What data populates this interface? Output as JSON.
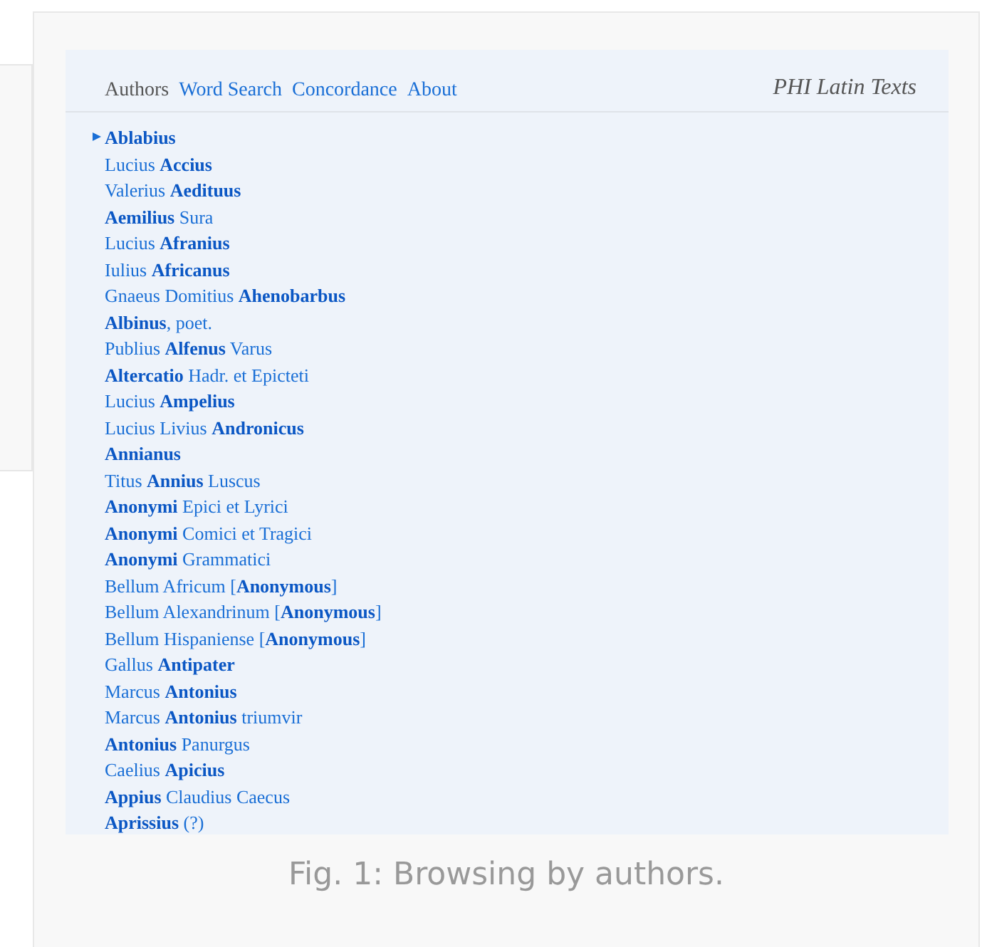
{
  "nav": [
    {
      "label": "Authors",
      "selected": true
    },
    {
      "label": "Word Search",
      "selected": false
    },
    {
      "label": "Concordance",
      "selected": false
    },
    {
      "label": "About",
      "selected": false
    }
  ],
  "site_title": "PHI Latin Texts",
  "authors": [
    {
      "name": "**Ablabius**",
      "selected": true
    },
    {
      "name": "Lucius **Accius**",
      "selected": false
    },
    {
      "name": "Valerius **Aedituus**",
      "selected": false
    },
    {
      "name": "**Aemilius** Sura",
      "selected": false
    },
    {
      "name": "Lucius **Afranius**",
      "selected": false
    },
    {
      "name": "Iulius **Africanus**",
      "selected": false
    },
    {
      "name": "Gnaeus Domitius **Ahenobarbus**",
      "selected": false
    },
    {
      "name": "**Albinus**, poet.",
      "selected": false
    },
    {
      "name": "Publius **Alfenus** Varus",
      "selected": false
    },
    {
      "name": "**Altercatio** Hadr. et Epicteti",
      "selected": false
    },
    {
      "name": "Lucius **Ampelius**",
      "selected": false
    },
    {
      "name": "Lucius Livius **Andronicus**",
      "selected": false
    },
    {
      "name": "**Annianus**",
      "selected": false
    },
    {
      "name": "Titus **Annius** Luscus",
      "selected": false
    },
    {
      "name": "**Anonymi** Epici et Lyrici",
      "selected": false
    },
    {
      "name": "**Anonymi** Comici et Tragici",
      "selected": false
    },
    {
      "name": "**Anonymi** Grammatici",
      "selected": false
    },
    {
      "name": "Bellum Africum [**Anonymous**]",
      "selected": false
    },
    {
      "name": "Bellum Alexandrinum [**Anonymous**]",
      "selected": false
    },
    {
      "name": "Bellum Hispaniense [**Anonymous**]",
      "selected": false
    },
    {
      "name": "Gallus **Antipater**",
      "selected": false
    },
    {
      "name": "Marcus **Antonius**",
      "selected": false
    },
    {
      "name": "Marcus **Antonius** triumvir",
      "selected": false
    },
    {
      "name": "**Antonius** Panurgus",
      "selected": false
    },
    {
      "name": "Caelius **Apicius**",
      "selected": false
    },
    {
      "name": "**Appius** Claudius Caecus",
      "selected": false
    },
    {
      "name": "**Aprissius** (?)",
      "selected": false
    }
  ],
  "caption": "Fig. 1: Browsing by authors."
}
